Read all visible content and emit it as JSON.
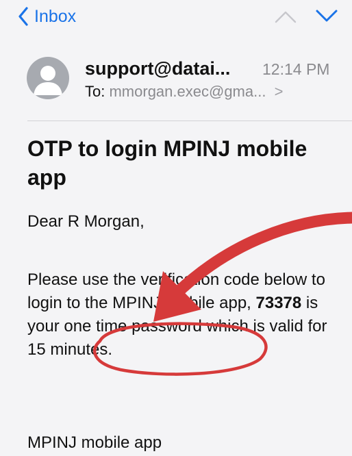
{
  "nav": {
    "back_label": "Inbox"
  },
  "message": {
    "sender": "support@datai...",
    "time": "12:14 PM",
    "to_label": "To:",
    "to_address": "mmorgan.exec@gma...",
    "subject": "OTP to login MPINJ mobile app",
    "greeting": "Dear R Morgan,",
    "paragraph_before_code": "Please use the verification code below to login to the MPINJ mobile app, ",
    "code": "73378",
    "paragraph_after_code": " is your one time password which is valid for 15 minutes.",
    "signature": "MPINJ mobile app"
  },
  "colors": {
    "accent": "#1a73e8",
    "annotation": "#d63a3a",
    "muted_text": "#8a8a8e",
    "background": "#f4f4f6"
  }
}
